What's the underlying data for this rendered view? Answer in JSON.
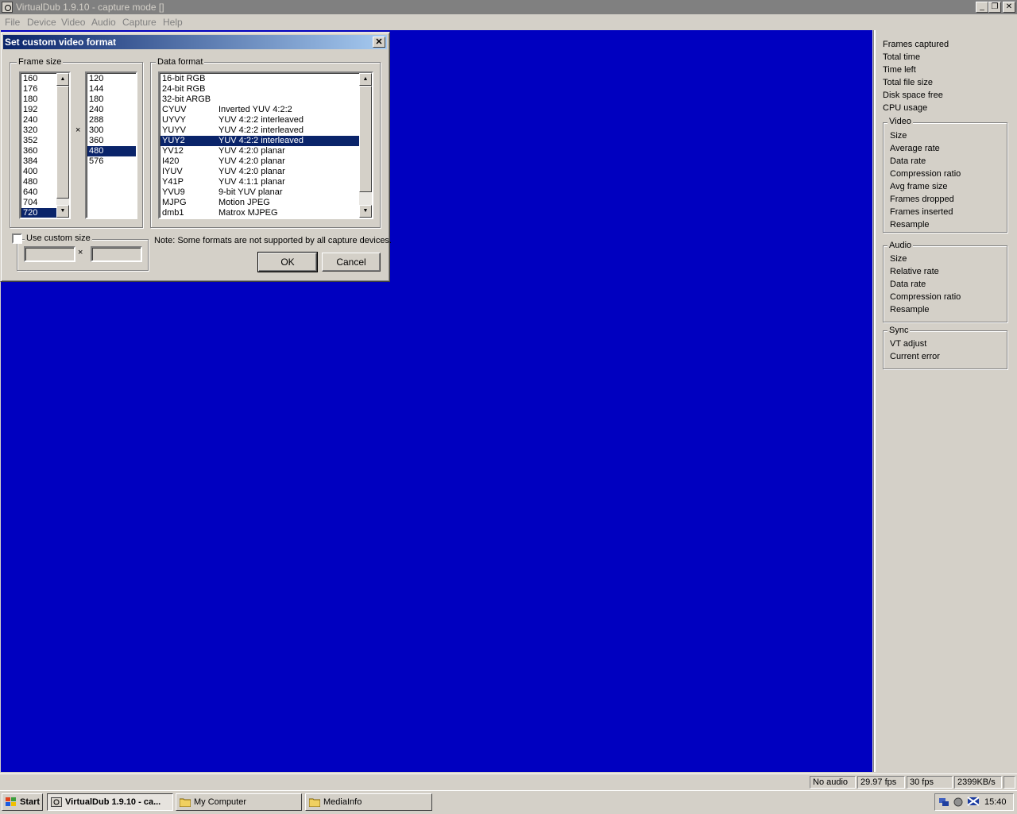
{
  "window": {
    "title": "VirtualDub 1.9.10 - capture mode []"
  },
  "menu": [
    "File",
    "Device",
    "Video",
    "Audio",
    "Capture",
    "Help"
  ],
  "dialog": {
    "title": "Set custom video format",
    "frame_size_label": "Frame size",
    "widths": [
      "160",
      "176",
      "180",
      "192",
      "240",
      "320",
      "352",
      "360",
      "384",
      "400",
      "480",
      "640",
      "704",
      "720"
    ],
    "selected_width": "720",
    "times_symbol": "×",
    "heights": [
      "120",
      "144",
      "180",
      "240",
      "288",
      "300",
      "360",
      "480",
      "576"
    ],
    "selected_height": "480",
    "data_format_label": "Data format",
    "formats": [
      {
        "code": "16-bit RGB",
        "desc": ""
      },
      {
        "code": "24-bit RGB",
        "desc": ""
      },
      {
        "code": "32-bit ARGB",
        "desc": ""
      },
      {
        "code": "CYUV",
        "desc": "Inverted YUV 4:2:2"
      },
      {
        "code": "UYVY",
        "desc": "YUV 4:2:2 interleaved"
      },
      {
        "code": "YUYV",
        "desc": "YUV 4:2:2 interleaved"
      },
      {
        "code": "YUY2",
        "desc": "YUV 4:2:2 interleaved"
      },
      {
        "code": "YV12",
        "desc": "YUV 4:2:0 planar"
      },
      {
        "code": "I420",
        "desc": "YUV 4:2:0 planar"
      },
      {
        "code": "IYUV",
        "desc": "YUV 4:2:0 planar"
      },
      {
        "code": "Y41P",
        "desc": "YUV 4:1:1 planar"
      },
      {
        "code": "YVU9",
        "desc": "9-bit YUV planar"
      },
      {
        "code": "MJPG",
        "desc": "Motion JPEG"
      },
      {
        "code": "dmb1",
        "desc": "Matrox MJPEG"
      }
    ],
    "selected_format": "YUY2",
    "custom_size_label": "Use custom size",
    "custom_size_checked": false,
    "note": "Note: Some formats are not supported by all capture devices.",
    "ok_label": "OK",
    "cancel_label": "Cancel"
  },
  "panel": {
    "stats": [
      "Frames captured",
      "Total time",
      "Time left",
      "Total file size",
      "Disk space free",
      "CPU usage"
    ],
    "video": {
      "title": "Video",
      "items": [
        "Size",
        "Average rate",
        "Data rate",
        "Compression ratio",
        "Avg frame size",
        "Frames dropped",
        "Frames inserted",
        "Resample"
      ]
    },
    "audio": {
      "title": "Audio",
      "items": [
        "Size",
        "Relative rate",
        "Data rate",
        "Compression ratio",
        "Resample"
      ]
    },
    "sync": {
      "title": "Sync",
      "items": [
        "VT adjust",
        "Current error"
      ]
    }
  },
  "status": [
    "No audio",
    "29.97 fps",
    "30 fps",
    "2399KB/s"
  ],
  "taskbar": {
    "start_label": "Start",
    "buttons": [
      "VirtualDub 1.9.10 - ca...",
      "My Computer",
      "MediaInfo"
    ],
    "clock": "15:40"
  },
  "colors": {
    "video_bg": "#0000c0",
    "selection": "#0a246a",
    "title_gradient_start": "#0a246a"
  }
}
